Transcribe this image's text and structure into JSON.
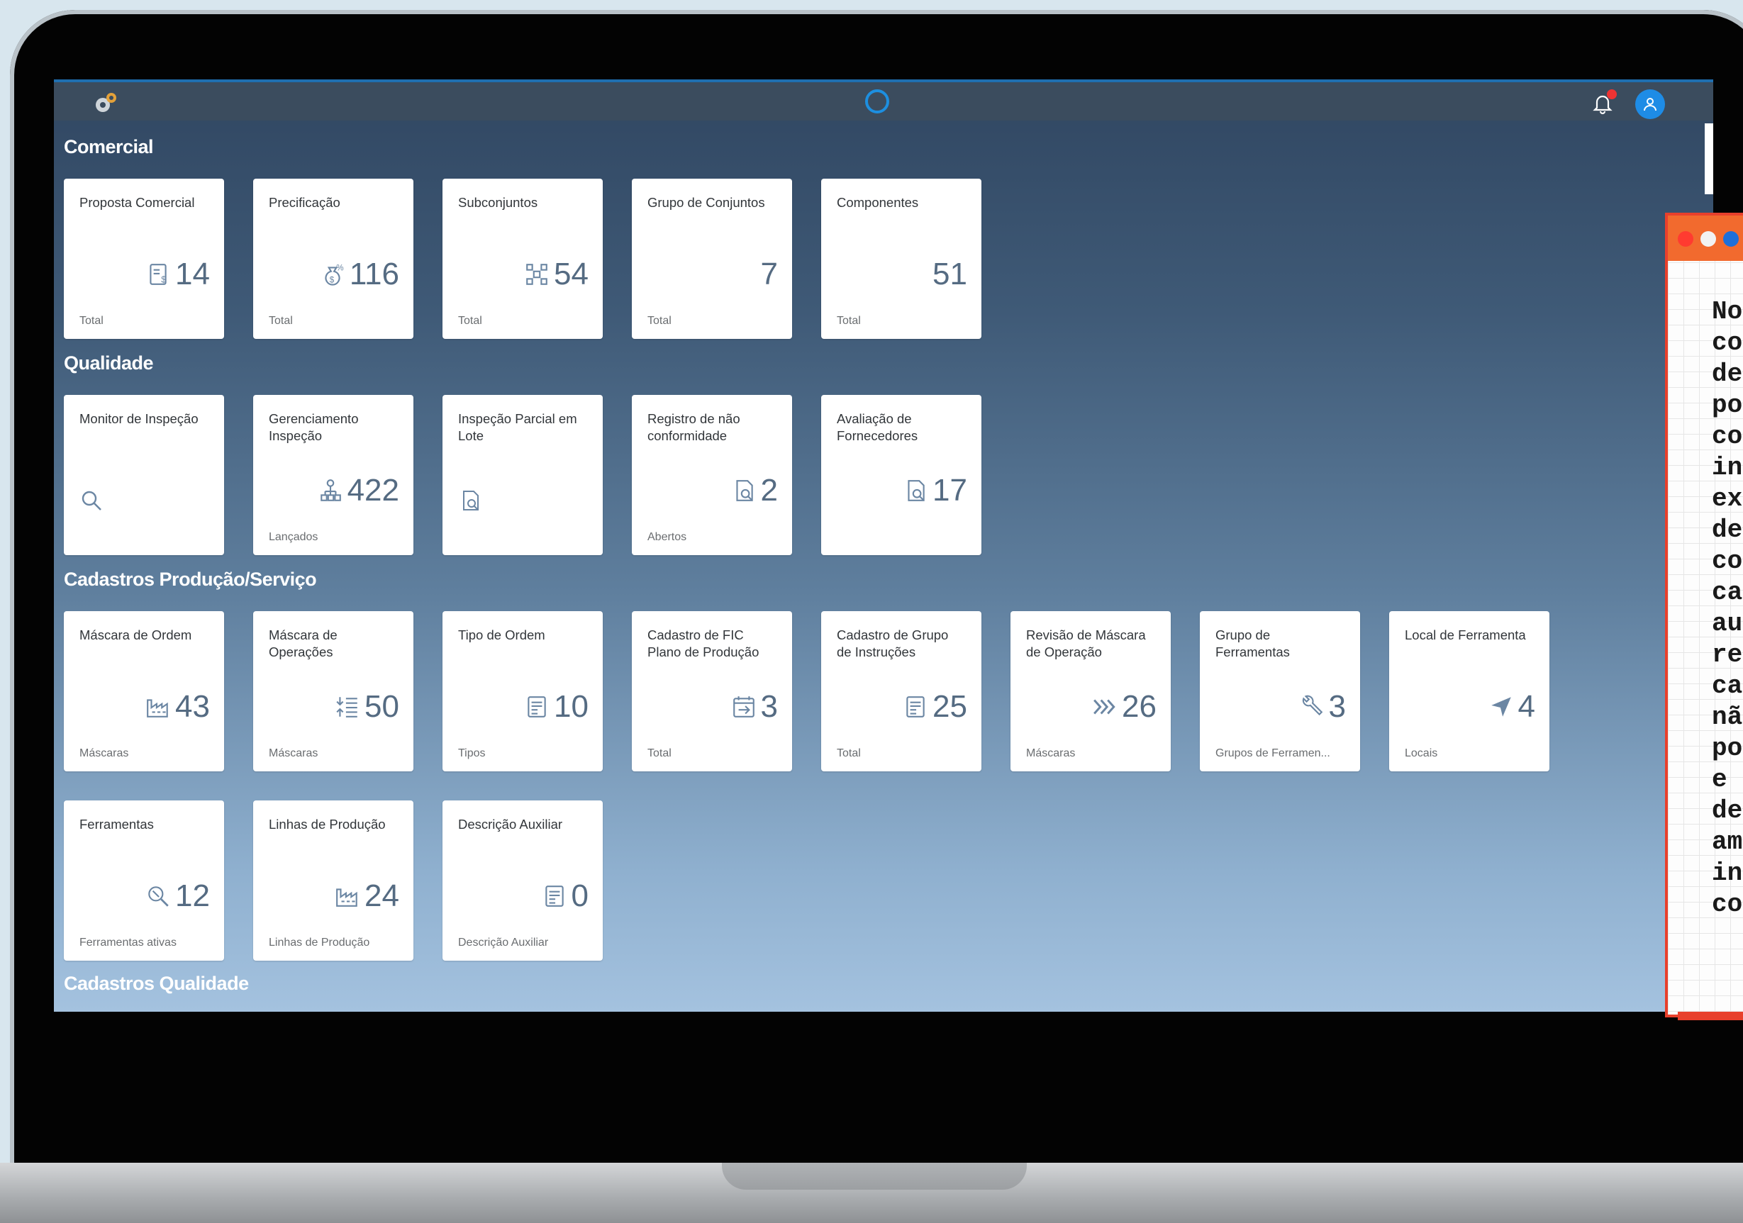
{
  "groups": [
    {
      "title": "Comercial",
      "tiles": [
        {
          "title": "Proposta Comercial",
          "value": "14",
          "sub": "Total",
          "icon": "invoice-icon"
        },
        {
          "title": "Precificação",
          "value": "116",
          "sub": "Total",
          "icon": "money-bag-icon"
        },
        {
          "title": "Subconjuntos",
          "value": "54",
          "sub": "Total",
          "icon": "network-icon"
        },
        {
          "title": "Grupo de Conjuntos",
          "value": "7",
          "sub": "Total",
          "icon": ""
        },
        {
          "title": "Componentes",
          "value": "51",
          "sub": "Total",
          "icon": ""
        }
      ]
    },
    {
      "title": "Qualidade",
      "tiles": [
        {
          "title": "Monitor de Inspeção",
          "value": "",
          "sub": "",
          "icon": "search-icon"
        },
        {
          "title": "Gerenciamento Inspeção",
          "value": "422",
          "sub": "Lançados",
          "icon": "org-chart-icon"
        },
        {
          "title": "Inspeção Parcial em Lote",
          "value": "",
          "sub": "",
          "icon": "document-search-icon"
        },
        {
          "title": "Registro de não conformidade",
          "value": "2",
          "sub": "Abertos",
          "icon": "document-search-icon"
        },
        {
          "title": "Avaliação de Fornecedores",
          "value": "17",
          "sub": "",
          "icon": "document-search-icon"
        }
      ]
    },
    {
      "title": "Cadastros Produção/Serviço",
      "tiles": [
        {
          "title": "Máscara de Ordem",
          "value": "43",
          "sub": "Máscaras",
          "icon": "factory-icon"
        },
        {
          "title": "Máscara de Operações",
          "value": "50",
          "sub": "Máscaras",
          "icon": "list-arrows-icon"
        },
        {
          "title": "Tipo de Ordem",
          "value": "10",
          "sub": "Tipos",
          "icon": "form-icon"
        },
        {
          "title": "Cadastro de FIC Plano de Produção",
          "value": "3",
          "sub": "Total",
          "icon": "calendar-arrow-icon"
        },
        {
          "title": "Cadastro de Grupo de Instruções",
          "value": "25",
          "sub": "Total",
          "icon": "form-icon"
        },
        {
          "title": "Revisão de Máscara de Operação",
          "value": "26",
          "sub": "Máscaras",
          "icon": "process-chevron-icon"
        },
        {
          "title": "Grupo de Ferramentas",
          "value": "3",
          "sub": "Grupos de Ferramen...",
          "icon": "wrench-icon"
        },
        {
          "title": "Local de Ferramenta",
          "value": "4",
          "sub": "Locais",
          "icon": "location-arrow-icon"
        },
        {
          "title": "Ferramentas",
          "value": "12",
          "sub": "Ferramentas ativas",
          "icon": "tool-search-icon"
        },
        {
          "title": "Linhas de Produção",
          "value": "24",
          "sub": "Linhas de Produção",
          "icon": "factory-icon"
        },
        {
          "title": "Descrição Auxiliar",
          "value": "0",
          "sub": "Descrição Auxiliar",
          "icon": "form-icon"
        }
      ]
    },
    {
      "title": "Cadastros Qualidade",
      "tiles": []
    }
  ],
  "shell": {
    "logo": "company-logo",
    "copilot": "copilot-icon",
    "bell": "bell-icon",
    "avatar": "user-avatar"
  },
  "note": {
    "text": "No\nco\nde\npo\nco\nin\nex\nde\nco\nca\nau\nre\nca\nnã\npo\ne \nde\nam\nin\nco"
  },
  "colors": {
    "accent": "#1e8ce6",
    "note_border": "#e8402c",
    "icon": "#556b82"
  }
}
